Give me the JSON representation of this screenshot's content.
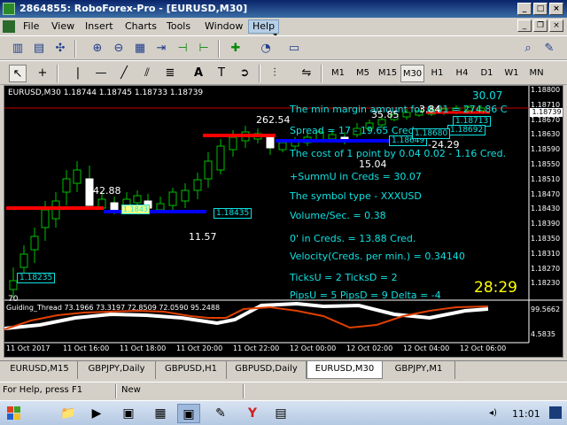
{
  "window": {
    "title": "2864855: RoboForex-Pro - [EURUSD,M30]"
  },
  "menu": {
    "items": [
      {
        "label": "File",
        "x": 0
      },
      {
        "label": "View"
      },
      {
        "label": "Insert"
      },
      {
        "label": "Charts"
      },
      {
        "label": "Tools"
      },
      {
        "label": "Window"
      },
      {
        "label": "Help"
      }
    ]
  },
  "timeframes": [
    "M1",
    "M5",
    "M15",
    "M30",
    "H1",
    "H4",
    "D1",
    "W1",
    "MN"
  ],
  "active_timeframe": "M30",
  "chart": {
    "header": "EURUSD,M30  1.18744 1.18745 1.18733 1.18739",
    "price_axis": [
      "1.18800",
      "1.18739",
      "1.18710",
      "1.18670",
      "1.18630",
      "1.18590",
      "1.18550",
      "1.18510",
      "1.18470",
      "1.18430",
      "1.18390",
      "1.18350",
      "1.18310",
      "1.18270",
      "1.18230"
    ],
    "current_price": "1.18739",
    "indicator_axis": [
      "99.5662",
      "4.5835"
    ],
    "indicator_label": "Guiding_Thread 73.1966 73.3197 72.8509 72.0590 95.2488",
    "time_axis": [
      "11 Oct 2017",
      "11 Oct 16:00",
      "11 Oct 18:00",
      "11 Oct 20:00",
      "11 Oct 22:00",
      "12 Oct 00:00",
      "12 Oct 02:00",
      "12 Oct 04:00",
      "12 Oct 06:00"
    ],
    "overlay_text": {
      "min_margin": "The min margin amount for 0.01 = 274.86 C",
      "spread": "Spread = 17 - 19.65 Creds",
      "cost": "The cost of 1 point  by 0.04 0.02 - 1.16 Cred.",
      "summu": "+SummU in Creds = 30.07",
      "symbol_type": "The symbol type - XXXUSD",
      "volume": "Volume/Sec. = 0.38",
      "zero_creds": "0' in Creds. = 13.88 Cred.",
      "velocity": "Velocity(Creds. per min.) = 0.34140",
      "ticks": "TicksU = 2 TicksD = 2",
      "pips": "PipsU = 5 PipsD = 9 Delta = -4",
      "timer": "28:29",
      "top_value": "30.07"
    },
    "labels": {
      "l1": "262.54",
      "l2": "42.88",
      "l3": "11.57",
      "l4": "35.85",
      "l5": "-24.29",
      "l6": "15.04",
      "l7": "3.84",
      "l8": "70"
    },
    "price_boxes": {
      "b1": "1.18435",
      "b2": "1.18235",
      "b3": "1.18649",
      "b4": "1.1843",
      "b5": "1.18713",
      "b6": "1.18692",
      "b7": "1.18680"
    }
  },
  "chart_tabs": [
    "EURUSD,M15",
    "GBPJPY,Daily",
    "GBPUSD,H1",
    "GBPUSD,Daily",
    "EURUSD,M30",
    "GBPJPY,M1"
  ],
  "active_chart_tab": "EURUSD,M30",
  "status": {
    "help": "For Help, press F1",
    "profile": "New"
  },
  "taskbar": {
    "time": "11:01"
  }
}
